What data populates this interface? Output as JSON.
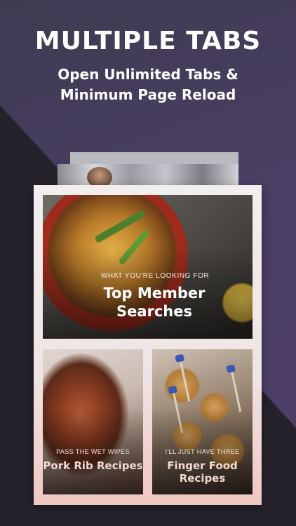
{
  "header": {
    "title": "MULTIPLE TABS",
    "subtitle": "Open Unlimited Tabs & Minimum Page Reload"
  },
  "card": {
    "hero": {
      "kicker": "WHAT YOU'RE LOOKING FOR",
      "title": "Top Member Searches"
    },
    "tiles": [
      {
        "kicker": "PASS THE WET WIPES",
        "title": "Pork Rib Recipes"
      },
      {
        "kicker": "I'LL JUST HAVE THREE",
        "title": "Finger Food Recipes"
      }
    ]
  },
  "colors": {
    "background": "#4a3f64",
    "diagonal_band": "#25222c",
    "card": "#f3eeee",
    "tile_title": "#f2d8d2"
  }
}
